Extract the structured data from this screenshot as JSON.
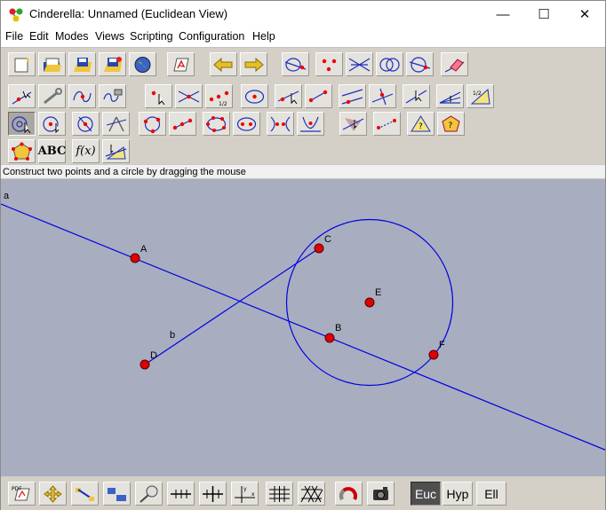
{
  "window": {
    "title": "Cinderella: Unnamed (Euclidean View)",
    "minimize_glyph": "—",
    "maximize_glyph": "☐",
    "close_glyph": "✕"
  },
  "menu": {
    "items": [
      "File",
      "Edit",
      "Modes",
      "Views",
      "Scripting",
      "Configuration",
      "Help"
    ]
  },
  "toolbar": {
    "abc_label": "ABC",
    "fx_label": "f(x)",
    "ratio_label": "1/2",
    "question_label": "?",
    "pdf_label": "PDF",
    "selected_tool": "circle-by-points-tool"
  },
  "status": {
    "message": "Construct two points and a circle by dragging the mouse"
  },
  "canvas": {
    "colors": {
      "background": "#a8aec0",
      "line": "#0000e0",
      "point_fill": "#e00000",
      "point_stroke": "#500000"
    },
    "labels": {
      "a": "a",
      "b": "b",
      "A": "A",
      "B": "B",
      "C": "C",
      "D": "D",
      "E": "E",
      "F": "F"
    }
  },
  "bottom": {
    "modes": [
      "Euc",
      "Hyp",
      "Ell"
    ],
    "selected_mode": "Euc"
  }
}
